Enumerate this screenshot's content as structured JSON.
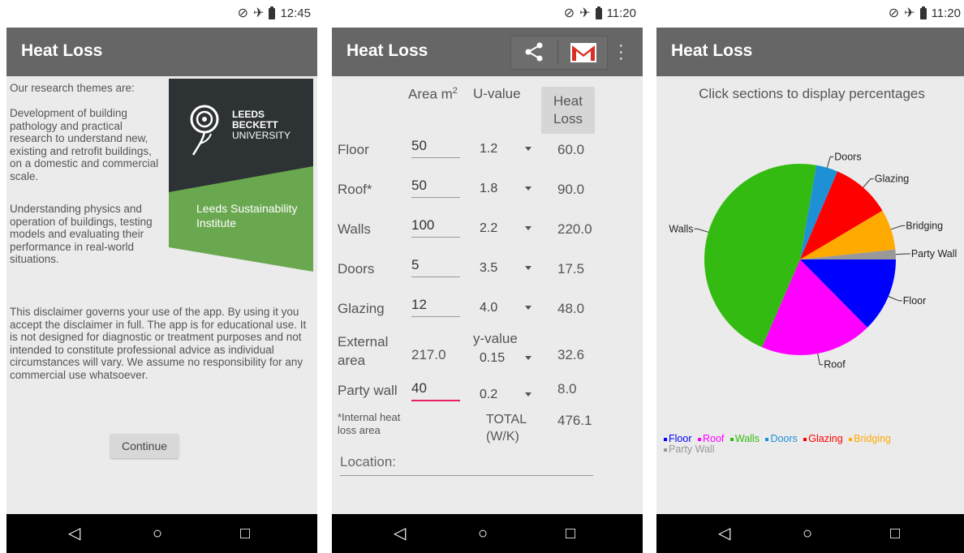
{
  "screens": [
    {
      "status_time": "12:45",
      "app_title": "Heat Loss",
      "intro": "Our research themes are:",
      "theme1": "Development of building pathology and practical research to understand new, existing and retrofit buildings, on a domestic and commercial scale.",
      "theme2": "Understanding physics and operation of buildings, testing models and evaluating their performance in real-world situations.",
      "logo_lines": [
        "LEEDS",
        "BECKETT",
        "UNIVERSITY"
      ],
      "institute_lines": [
        "Leeds Sustainability",
        "Institute"
      ],
      "disclaimer": "This disclaimer governs your use of the app. By using it you accept the disclaimer in full. The app is for educational use. It is not designed for diagnostic or treatment purposes and not intended to constitute professional advice as individual circumstances will vary. We assume no responsibility for any commercial use whatsoever.",
      "continue_label": "Continue"
    },
    {
      "status_time": "11:20",
      "app_title": "Heat Loss",
      "col_area": "Area m",
      "col_area_sup": "2",
      "col_uvalue": "U-value",
      "col_heatloss": [
        "Heat",
        "Loss"
      ],
      "rows": [
        {
          "label": "Floor",
          "area": "50",
          "u": "1.2",
          "heat": "60.0"
        },
        {
          "label": "Roof*",
          "area": "50",
          "u": "1.8",
          "heat": "90.0"
        },
        {
          "label": "Walls",
          "area": "100",
          "u": "2.2",
          "heat": "220.0"
        },
        {
          "label": "Doors",
          "area": "5",
          "u": "3.5",
          "heat": "17.5"
        },
        {
          "label": "Glazing",
          "area": "12",
          "u": "4.0",
          "heat": "48.0"
        }
      ],
      "external": {
        "label_lines": [
          "External",
          "area"
        ],
        "area": "217.0",
        "yvalue_label": "y-value",
        "y": "0.15",
        "heat": "32.6"
      },
      "party": {
        "label": "Party wall",
        "area": "40",
        "u": "0.2",
        "heat": "8.0"
      },
      "footnote_lines": [
        "*Internal heat",
        "loss area"
      ],
      "total_lines": [
        "TOTAL",
        "(W/K)"
      ],
      "total_value": "476.1",
      "location_placeholder": "Location:"
    },
    {
      "status_time": "11:20",
      "app_title": "Heat Loss",
      "caption": "Click sections to display percentages",
      "legend": [
        {
          "name": "Floor",
          "color": "#0000ff"
        },
        {
          "name": "Roof",
          "color": "#ff00ff"
        },
        {
          "name": "Walls",
          "color": "#33bb11"
        },
        {
          "name": "Doors",
          "color": "#1e90d6"
        },
        {
          "name": "Glazing",
          "color": "#ff0000"
        },
        {
          "name": "Bridging",
          "color": "#ffaa00"
        },
        {
          "name": "Party Wall",
          "color": "#999999"
        }
      ]
    }
  ],
  "chart_data": {
    "type": "pie",
    "categories": [
      "Floor",
      "Roof",
      "Walls",
      "Doors",
      "Glazing",
      "Bridging",
      "Party Wall"
    ],
    "values": [
      60.0,
      90.0,
      220.0,
      17.5,
      48.0,
      32.6,
      8.0
    ],
    "colors": [
      "#0000ff",
      "#ff00ff",
      "#33bb11",
      "#1e90d6",
      "#ff0000",
      "#ffaa00",
      "#999999"
    ],
    "legend_position": "bottom-left"
  }
}
